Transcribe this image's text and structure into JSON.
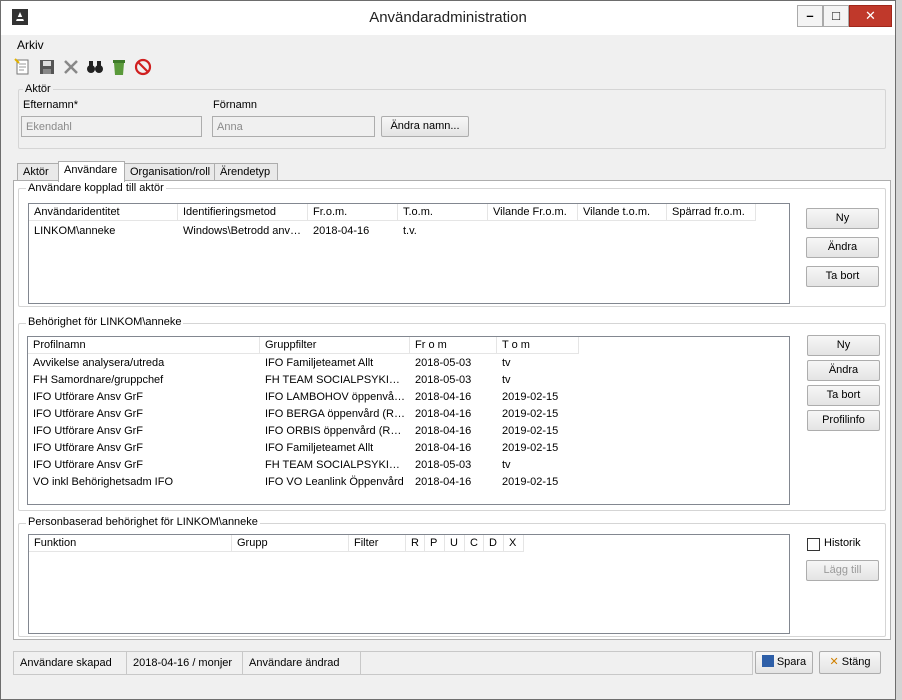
{
  "window": {
    "title": "Användaradministration"
  },
  "menu": {
    "arkiv": "Arkiv"
  },
  "toolbar_icons": [
    "new-icon",
    "save-icon",
    "delete-icon",
    "search-binoculars-icon",
    "recycle-icon",
    "stop-icon"
  ],
  "actor": {
    "group_label": "Aktör",
    "lastname_label": "Efternamn*",
    "lastname_value": "Ekendahl",
    "firstname_label": "Förnamn",
    "firstname_value": "Anna",
    "change_name_button": "Ändra namn..."
  },
  "tabs": [
    "Aktör",
    "Användare",
    "Organisation/roll",
    "Ärendetyp"
  ],
  "users": {
    "group_label": "Användare kopplad till aktör",
    "columns": [
      "Användaridentitet",
      "Identifieringsmetod",
      "Fr.o.m.",
      "T.o.m.",
      "Vilande Fr.o.m.",
      "Vilande t.o.m.",
      "Spärrad fr.o.m."
    ],
    "rows": [
      [
        "LINKOM\\anneke",
        "Windows\\Betrodd anv…",
        "2018-04-16",
        "t.v.",
        "",
        "",
        ""
      ]
    ],
    "btn_new": "Ny",
    "btn_edit": "Ändra",
    "btn_remove": "Ta bort"
  },
  "permissions": {
    "group_label": "Behörighet för LINKOM\\anneke",
    "columns": [
      "Profilnamn",
      "Gruppfilter",
      "Fr o m",
      "T o m"
    ],
    "rows": [
      [
        "Avvikelse analysera/utreda",
        "IFO Familjeteamet Allt",
        "2018-05-03",
        "tv"
      ],
      [
        "FH Samordnare/gruppchef",
        "FH TEAM SOCIALPSYKIAT…",
        "2018-05-03",
        "tv"
      ],
      [
        "IFO Utförare Ansv GrF",
        "IFO LAMBOHOV öppenvår…",
        "2018-04-16",
        "2019-02-15"
      ],
      [
        "IFO Utförare Ansv GrF",
        "IFO BERGA öppenvård (R…",
        "2018-04-16",
        "2019-02-15"
      ],
      [
        "IFO Utförare Ansv GrF",
        "IFO ORBIS öppenvård (R&S)",
        "2018-04-16",
        "2019-02-15"
      ],
      [
        "IFO Utförare Ansv GrF",
        "IFO Familjeteamet Allt",
        "2018-04-16",
        "2019-02-15"
      ],
      [
        "IFO Utförare Ansv GrF",
        "FH TEAM SOCIALPSYKIAT…",
        "2018-05-03",
        "tv"
      ],
      [
        "VO inkl Behörighetsadm IFO",
        "IFO VO Leanlink Öppenvård",
        "2018-04-16",
        "2019-02-15"
      ]
    ],
    "btn_new": "Ny",
    "btn_edit": "Ändra",
    "btn_remove": "Ta bort",
    "btn_profileinfo": "Profilinfo"
  },
  "personal": {
    "group_label": "Personbaserad behörighet för LINKOM\\anneke",
    "columns": [
      "Funktion",
      "Grupp",
      "Filter",
      "R",
      "P",
      "U",
      "C",
      "D",
      "X"
    ],
    "history_label": "Historik",
    "btn_add": "Lägg till"
  },
  "status": {
    "created_label": "Användare skapad",
    "created_value": "2018-04-16 / monjer",
    "changed_label": "Användare ändrad",
    "changed_value": ""
  },
  "footer": {
    "save": "Spara",
    "close": "Stäng"
  }
}
